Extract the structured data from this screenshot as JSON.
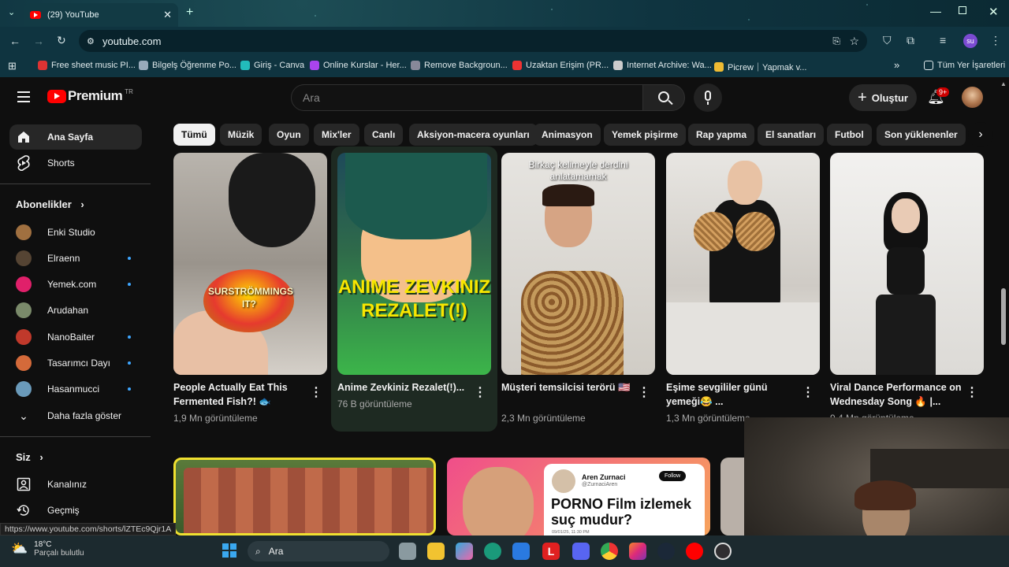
{
  "browser": {
    "tab_title": "(29) YouTube",
    "url": "youtube.com",
    "bookmarks": [
      {
        "label": "Free sheet music PI...",
        "color": "#d33"
      },
      {
        "label": "Bilgelş Öğrenme Po...",
        "color": "#9ab"
      },
      {
        "label": "Giriş - Canva",
        "color": "#2bb"
      },
      {
        "label": "Online Kurslar - Her...",
        "color": "#a4e"
      },
      {
        "label": "Remove Backgroun...",
        "color": "#889"
      },
      {
        "label": "Uzaktan Erişim (PR...",
        "color": "#e33"
      },
      {
        "label": "Internet Archive: Wa...",
        "color": "#ccc"
      },
      {
        "label": "Picrew｜Yapmak v...",
        "color": "#eb3"
      }
    ],
    "bookmarks_more": "»",
    "all_bookmarks": "Tüm Yer İşaretleri",
    "profile": "su"
  },
  "header": {
    "logo_text": "Premium",
    "logo_region": "TR",
    "search_placeholder": "Ara",
    "create_label": "Oluştur",
    "notif_count": "9+"
  },
  "chips": [
    "Tümü",
    "Müzik",
    "Oyun",
    "Mix'ler",
    "Canlı",
    "Aksiyon-macera oyunları",
    "Animasyon",
    "Yemek pişirme",
    "Rap yapma",
    "El sanatları",
    "Futbol",
    "Son yüklenenler"
  ],
  "sidebar": {
    "home": "Ana Sayfa",
    "shorts": "Shorts",
    "subs_title": "Abonelikler",
    "subs": [
      {
        "name": "Enki Studio",
        "dot": false,
        "color": "#a07040"
      },
      {
        "name": "Elraenn",
        "dot": true,
        "color": "#554433"
      },
      {
        "name": "Yemek.com",
        "dot": true,
        "color": "#e0206a"
      },
      {
        "name": "Arudahan",
        "dot": false,
        "color": "#7a8a6a"
      },
      {
        "name": "NanoBaiter",
        "dot": true,
        "color": "#c0392b"
      },
      {
        "name": "Tasarımcı Dayı",
        "dot": true,
        "color": "#d46a3a"
      },
      {
        "name": "Hasanmucci",
        "dot": true,
        "color": "#6a9aba"
      }
    ],
    "more": "Daha fazla göster",
    "you_title": "Siz",
    "channel": "Kanalınız",
    "history": "Geçmiş"
  },
  "shorts": [
    {
      "title": "People Actually Eat This Fermented Fish?! 🐟",
      "views": "1,9 Mn görüntüleme",
      "thumb_text": "SURSTRÖMMINGS IT?"
    },
    {
      "title": "Anime Zevkiniz Rezalet(!)...",
      "views": "76 B görüntüleme",
      "thumb_text": "ANIME ZEVKINIZ REZALET(!)"
    },
    {
      "title": "Müşteri temsilcisi terörü 🇺🇸",
      "views": "2,3 Mn görüntüleme",
      "thumb_text": "Birkaç kelimeyle derdini anlatamamak"
    },
    {
      "title": "Eşime sevgililer günü yemeği😂 ...",
      "views": "1,3 Mn görüntüleme",
      "thumb_text": ""
    },
    {
      "title": "Viral Dance Performance on Wednesday Song 🔥 |...",
      "views": "9,4 Mn görüntüleme",
      "thumb_text": ""
    }
  ],
  "second_row": {
    "tweet_name": "Aren Zurnaci",
    "tweet_handle": "@ZurnaciAren",
    "tweet_follow": "Follow",
    "tweet_text": "PORNO Film izlemek suç mudur?",
    "tweet_date": "09/01/25, 11:30 PM"
  },
  "status_url": "https://www.youtube.com/shorts/lZTEc9Qjr1A",
  "taskbar": {
    "weather_temp": "18°C",
    "weather_desc": "Parçalı bulutlu",
    "search": "Ara"
  }
}
